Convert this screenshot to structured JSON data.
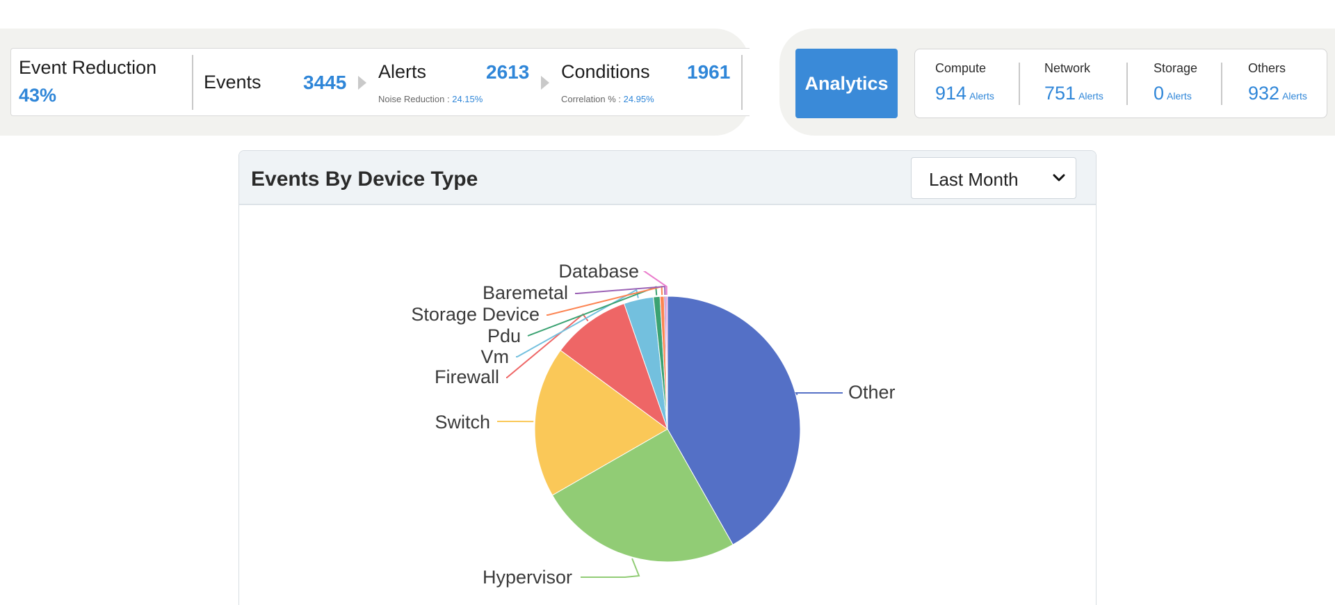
{
  "summary": {
    "event_reduction": {
      "label": "Event Reduction",
      "value": "43%"
    },
    "events": {
      "label": "Events",
      "value": "3445"
    },
    "alerts": {
      "label": "Alerts",
      "value": "2613",
      "sub_label": "Noise Reduction : ",
      "sub_value": "24.15%"
    },
    "conditions": {
      "label": "Conditions",
      "value": "1961",
      "sub_label": "Correlation % : ",
      "sub_value": "24.95%"
    }
  },
  "analytics_button": {
    "label": "Analytics",
    "color": "#3a8ad8"
  },
  "alert_categories": [
    {
      "name": "Compute",
      "count": "914",
      "unit": "Alerts"
    },
    {
      "name": "Network",
      "count": "751",
      "unit": "Alerts"
    },
    {
      "name": "Storage",
      "count": "0",
      "unit": "Alerts"
    },
    {
      "name": "Others",
      "count": "932",
      "unit": "Alerts"
    }
  ],
  "chart_panel": {
    "title": "Events By Device Type",
    "period_select": {
      "value": "Last Month",
      "icon": "chevron-down-icon"
    }
  },
  "chart_data": {
    "type": "pie",
    "title": "",
    "slices": [
      {
        "label": "Other",
        "value": 41.8,
        "color": "#5470c6"
      },
      {
        "label": "Hypervisor",
        "value": 24.9,
        "color": "#91cc75"
      },
      {
        "label": "Switch",
        "value": 18.4,
        "color": "#fac858"
      },
      {
        "label": "Firewall",
        "value": 9.6,
        "color": "#ee6666"
      },
      {
        "label": "Vm",
        "value": 3.6,
        "color": "#73c0de"
      },
      {
        "label": "Pdu",
        "value": 0.8,
        "color": "#3ba272"
      },
      {
        "label": "Storage Device",
        "value": 0.5,
        "color": "#fc8452"
      },
      {
        "label": "Baremetal",
        "value": 0.2,
        "color": "#9a60b4"
      },
      {
        "label": "Database",
        "value": 0.2,
        "color": "#ea7ccc"
      }
    ],
    "legend": "none"
  }
}
